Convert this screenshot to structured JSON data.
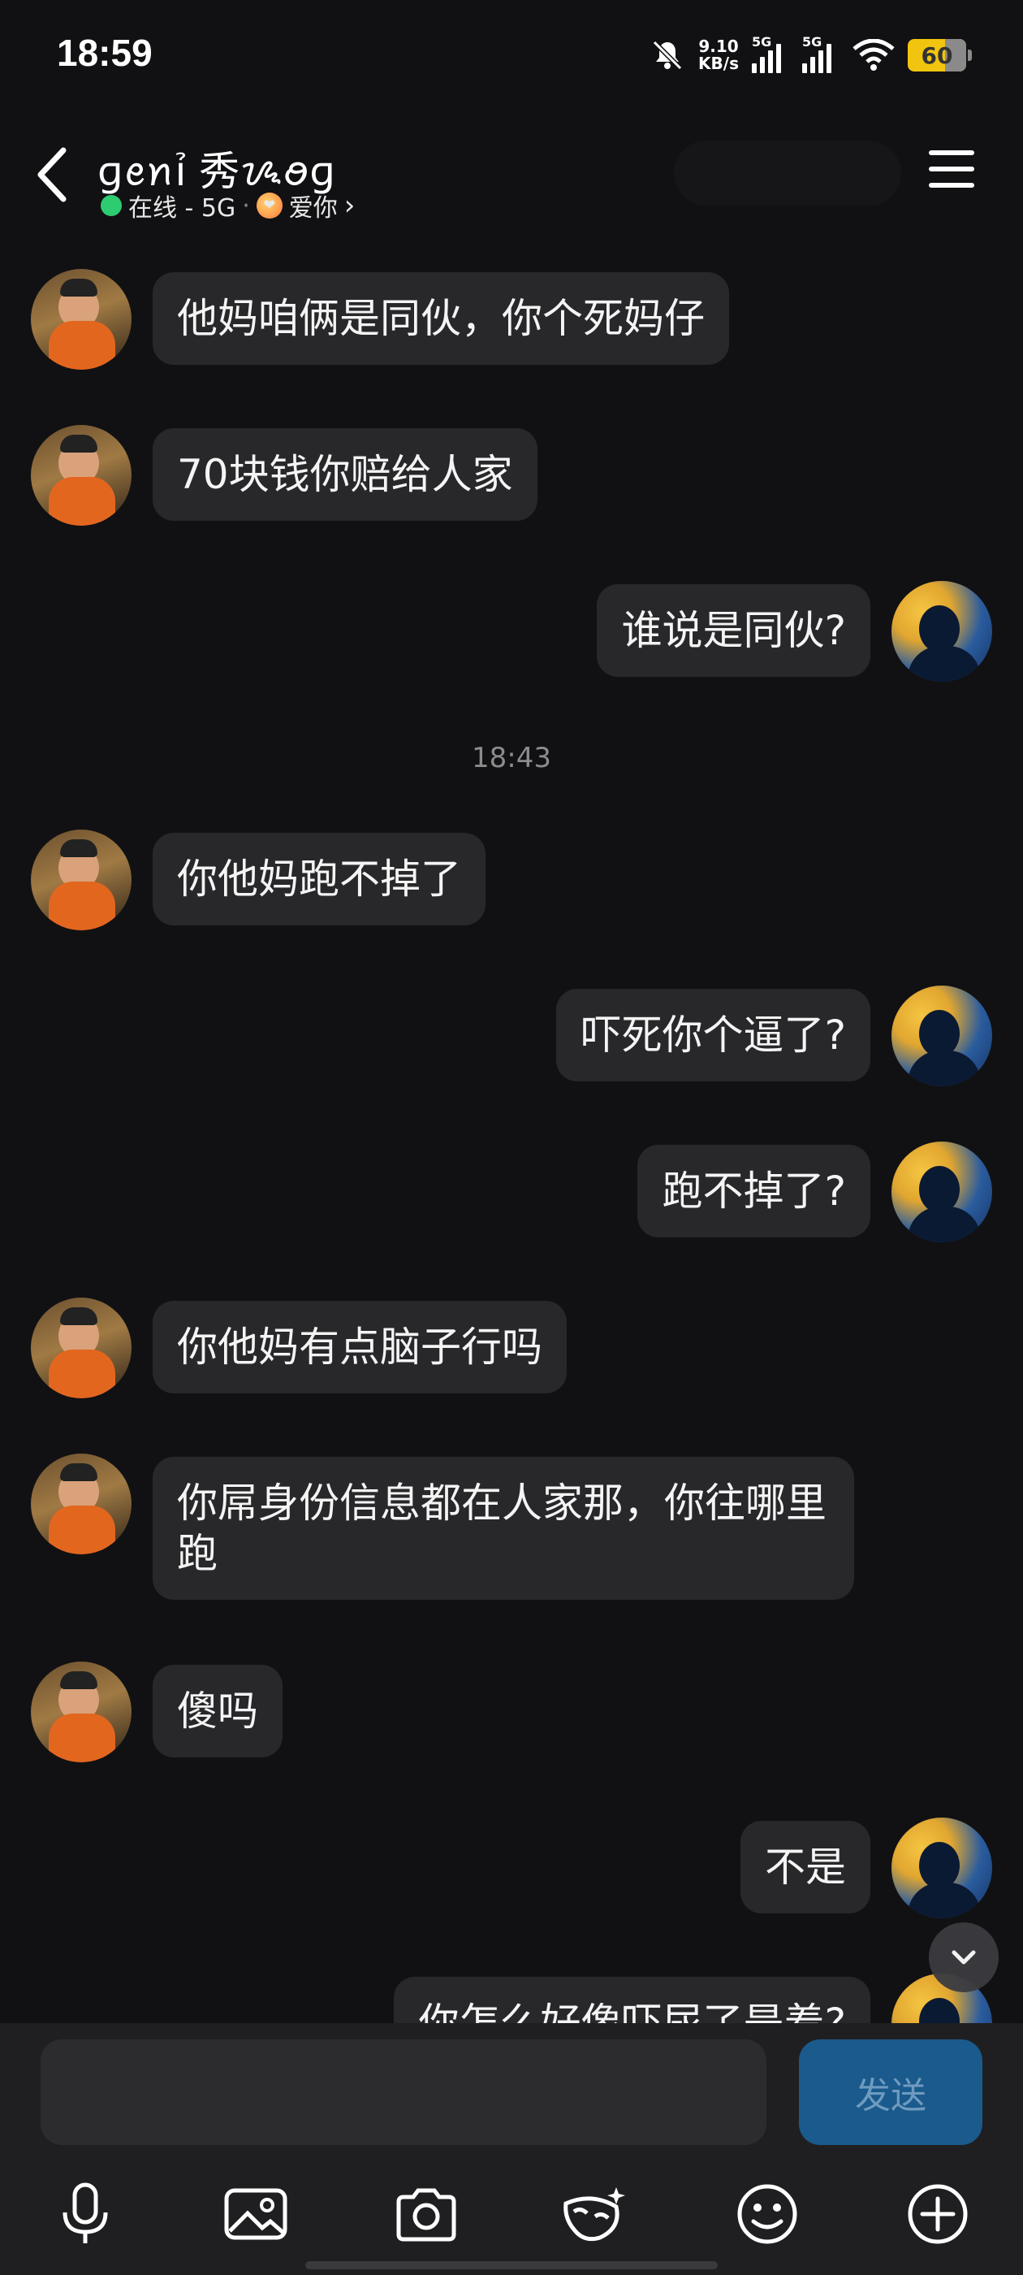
{
  "status_bar": {
    "time": "18:59",
    "net_speed_value": "9.10",
    "net_speed_unit": "KB/s",
    "signal1_label": "5G",
    "signal2_label": "5G",
    "battery": "60",
    "icons": [
      "bell-muted-icon",
      "signal-icon",
      "signal-icon",
      "wifi-icon",
      "battery-icon"
    ]
  },
  "header": {
    "title": "ɡꫀꪀỉ 秀ᝰꪮɡ",
    "status_text": "在线 - 5G",
    "separator": "·",
    "relation_text": "爱你",
    "chevron": "›"
  },
  "messages": [
    {
      "side": "left",
      "text": "他妈咱俩是同伙，你个死妈仔"
    },
    {
      "side": "left",
      "text": "70块钱你赔给人家"
    },
    {
      "side": "right",
      "text": "谁说是同伙?"
    },
    {
      "type": "time",
      "text": "18:43"
    },
    {
      "side": "left",
      "text": "你他妈跑不掉了"
    },
    {
      "side": "right",
      "text": "吓死你个逼了?"
    },
    {
      "side": "right",
      "text": "跑不掉了?"
    },
    {
      "side": "left",
      "text": "你他妈有点脑子行吗"
    },
    {
      "side": "left",
      "text": "你屌身份信息都在人家那，你往哪里跑"
    },
    {
      "side": "left",
      "text": "傻吗"
    },
    {
      "side": "right",
      "text": "不是"
    },
    {
      "side": "right",
      "text": "你怎么好像吓尿了是着?"
    }
  ],
  "composer": {
    "placeholder": "",
    "send_label": "发送"
  },
  "toolbar": [
    "microphone-icon",
    "image-icon",
    "camera-icon",
    "mask-icon",
    "emoji-icon",
    "plus-icon"
  ]
}
